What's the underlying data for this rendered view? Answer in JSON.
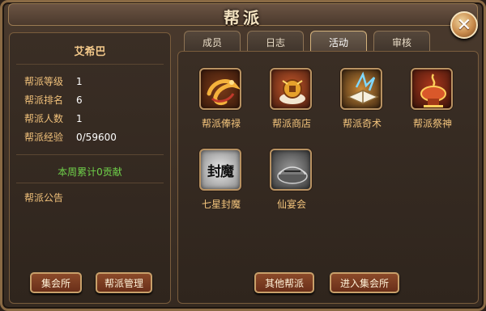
{
  "window": {
    "title": "帮派",
    "close_glyph": "✕"
  },
  "left_panel": {
    "guild_name": "艾希巴",
    "stats": [
      {
        "label": "帮派等级",
        "value": "1"
      },
      {
        "label": "帮派排名",
        "value": "6"
      },
      {
        "label": "帮派人数",
        "value": "1"
      },
      {
        "label": "帮派经验",
        "value": "0/59600"
      }
    ],
    "weekly_contribution": "本周累计0贡献",
    "notice_label": "帮派公告",
    "buttons": {
      "assembly_hall": "集会所",
      "guild_management": "帮派管理"
    }
  },
  "tabs": [
    {
      "label": "成员",
      "active": false
    },
    {
      "label": "日志",
      "active": false
    },
    {
      "label": "活动",
      "active": true
    },
    {
      "label": "审核",
      "active": false
    }
  ],
  "activities": [
    {
      "label": "帮派俸禄",
      "icon": "salary-icon"
    },
    {
      "label": "帮派商店",
      "icon": "shop-icon"
    },
    {
      "label": "帮派奇术",
      "icon": "magic-book-icon"
    },
    {
      "label": "帮派祭神",
      "icon": "altar-icon"
    },
    {
      "label": "七星封魔",
      "icon": "seal-demon-icon",
      "icon_text": "封魔"
    },
    {
      "label": "仙宴会",
      "icon": "banquet-icon"
    }
  ],
  "bottom_buttons": {
    "other_guilds": "其他帮派",
    "enter_assembly": "进入集会所"
  },
  "colors": {
    "accent_text": "#f0c07a",
    "green_text": "#6fd04a",
    "button_fill": "#7a3a20"
  }
}
